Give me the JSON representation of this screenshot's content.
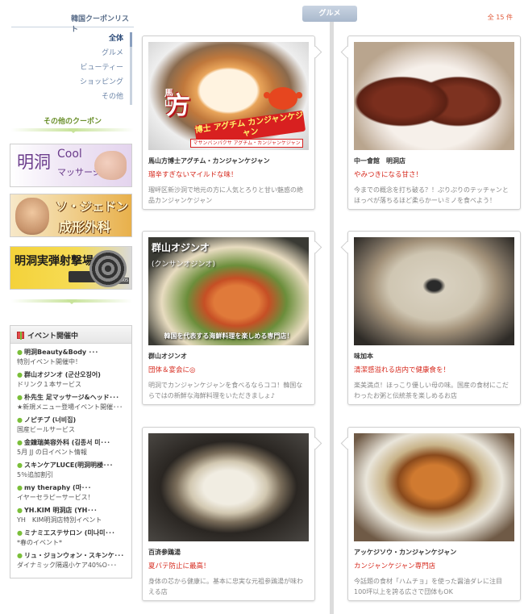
{
  "sidebar": {
    "title": "韓国クーポンリスト",
    "categories": [
      {
        "label": "全体",
        "active": true
      },
      {
        "label": "グルメ",
        "active": false
      },
      {
        "label": "ビューティー",
        "active": false
      },
      {
        "label": "ショッピング",
        "active": false
      },
      {
        "label": "その他",
        "active": false
      }
    ],
    "other_coupons_title": "その他のクーポン",
    "banners": [
      {
        "main": "明洞",
        "sub1": "Cool",
        "sub2": "マッサージ"
      },
      {
        "line1": "ソ・ジェドン",
        "line2": "成形外科"
      },
      {
        "main": "明洞実弾射撃場",
        "badge": "SINCE 2005"
      }
    ],
    "events": {
      "title": "イベント開催中",
      "items": [
        {
          "name": "明洞Beauty&Body ･･･",
          "desc": "特別イベント開催中！"
        },
        {
          "name": "群山オジンオ (군산오징어)",
          "desc": "ドリンク１本サービス"
        },
        {
          "name": "朴先生 足マッサージ&ヘッド･･･",
          "desc": "★新規メニュー登場イベント開催･･･"
        },
        {
          "name": "ノピチプ (너비집)",
          "desc": "国産ビールサービス"
        },
        {
          "name": "金鐘瑞美容外科 (김종서 미･･･",
          "desc": "5月 JJ の日イベント情報"
        },
        {
          "name": "スキンケアLUCE(明洞明楼･･･",
          "desc": "5％追加割引"
        },
        {
          "name": "my theraphy (마･･･",
          "desc": "イヤーセラピーサービス！"
        },
        {
          "name": "YH.KIM 明洞店 (YH･･･",
          "desc": "YH　KIM明洞店特別イベント"
        },
        {
          "name": "ミナミエステサロン (미나미･･･",
          "desc": "*春のイベント*"
        },
        {
          "name": "リュ・ジョンウォン・スキンケ･･･",
          "desc": "ダイナミック隔週小ケア40%O･･･"
        }
      ]
    }
  },
  "main": {
    "genre_tab": "グルメ",
    "total_count": "全 15 件",
    "cards": [
      {
        "name": "馬山方博士アグチム・カンジャンケジャン",
        "catch": "瑠辛すぎないマイルドな味！",
        "desc": "瑠岼区新沙洞で地元の方に人気とろりと甘い魅惑の絶品カンジャンケジャン",
        "image": {
          "logo_main": "方",
          "logo_small": "馬山",
          "band": "博士 アグチム カンジャンケジャン",
          "bar": "マサンバンパクサ アグチム・カンジャンケジャン"
        }
      },
      {
        "name": "中一會館　明洞店",
        "catch": "やみつきになる甘さ！",
        "desc": "今までの概念を打ち破る？！ぷりぷりのテッチャンとほっぺが落ちるほど柔らかーいミノを食べよう！"
      },
      {
        "name": "群山オジンオ",
        "catch": "団体＆宴会に◎",
        "desc": "明洞でカンジャンケジャンを食べるならココ！韓国ならではの新鮮な海鮮料理をいただきましょ♪",
        "image": {
          "title": "群山オジンオ",
          "sub": "(クンサンオジンオ)",
          "caption": "韓国を代表する海鮮料理を楽しめる専門店！"
        }
      },
      {
        "name": "味加本",
        "catch": "清潔感溢れる店内で健康食を！",
        "desc": "楽美満点！ほっこり優しい母の味。国産の食材にこだわったお粥と伝統茶を楽しめるお店"
      },
      {
        "name": "百済参鶏湯",
        "catch": "夏バテ防止に最高！",
        "desc": "身体の芯から健康に。基本に忠実な元祖参鶏湯が味わえる店"
      },
      {
        "name": "アッケジソウ・カンジャンケジャン",
        "catch": "カンジャンケジャン専門店",
        "desc": "今話題の食材「ハムチョ」を使った醤油ダレに注目100坪以上を誇る広さで団体もOK"
      }
    ]
  },
  "colors": {
    "accent_red": "#d6281c",
    "nav_blue": "#6d86a8",
    "green_accent": "#7bbf3a"
  }
}
